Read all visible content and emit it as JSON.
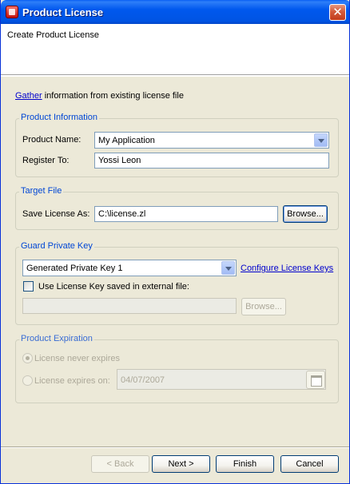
{
  "window": {
    "title": "Product License",
    "close_glyph": "✕"
  },
  "header": {
    "title": "Create Product License"
  },
  "gather": {
    "link": "Gather",
    "text": " information from existing license file"
  },
  "product_info": {
    "legend": "Product Information",
    "name_label": "Product Name:",
    "name_value": "My Application",
    "register_label": "Register To:",
    "register_value": "Yossi Leon"
  },
  "target_file": {
    "legend": "Target File",
    "save_label": "Save License As:",
    "save_value": "C:\\license.zl",
    "browse_label": "Browse..."
  },
  "guard_key": {
    "legend": "Guard Private Key",
    "key_value": "Generated Private Key 1",
    "configure_link": "Configure License Keys",
    "external_checkbox_label": "Use License Key saved in external file:",
    "external_checked": false,
    "external_path_value": "",
    "browse_label": "Browse..."
  },
  "expiration": {
    "legend": "Product Expiration",
    "never_label": "License never expires",
    "never_selected": true,
    "on_label": "License expires on:",
    "date_value": "04/07/2007"
  },
  "footer": {
    "back_label": "< Back",
    "next_label": "Next >",
    "finish_label": "Finish",
    "cancel_label": "Cancel"
  },
  "colors": {
    "titlebar": "#0054E3",
    "group_legend": "#0046D5",
    "link": "#0000CC",
    "dialog_bg": "#ECE9D8"
  },
  "icons": {
    "app": "app-icon",
    "close": "close-icon",
    "combo_arrow": "chevron-down-icon",
    "date_picker": "calendar-icon"
  }
}
